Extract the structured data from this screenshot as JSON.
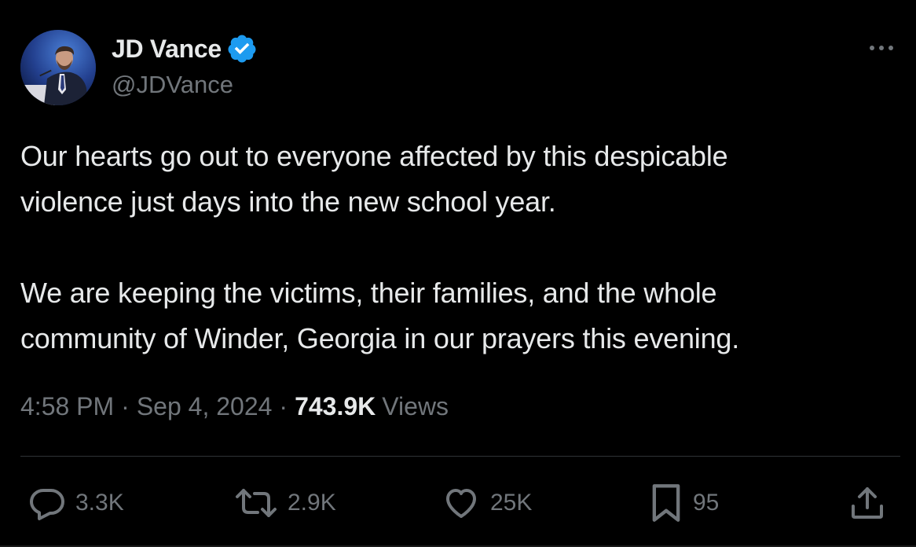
{
  "author": {
    "display_name": "JD Vance",
    "handle": "@JDVance",
    "verified": true,
    "verified_color": "#1d9bf0"
  },
  "tweet": {
    "text": "Our hearts go out to everyone affected by this despicable\nviolence just days into the new school year.\n\nWe are keeping the victims, their families, and the whole\ncommunity of Winder, Georgia in our prayers this evening.",
    "time": "4:58 PM",
    "separator": "·",
    "date": "Sep 4, 2024",
    "views_count": "743.9K",
    "views_label": "Views"
  },
  "actions": {
    "replies": "3.3K",
    "reposts": "2.9K",
    "likes": "25K",
    "bookmarks": "95"
  },
  "icons": {
    "more": "more-horizontal-icon",
    "reply": "reply-bubble-icon",
    "repost": "repost-arrows-icon",
    "like": "heart-icon",
    "bookmark": "bookmark-icon",
    "share": "share-upload-icon",
    "verified": "verified-badge-icon"
  },
  "colors": {
    "background": "#000000",
    "primary_text": "#e7e9ea",
    "secondary_text": "#71767b",
    "divider": "#2f3336"
  }
}
